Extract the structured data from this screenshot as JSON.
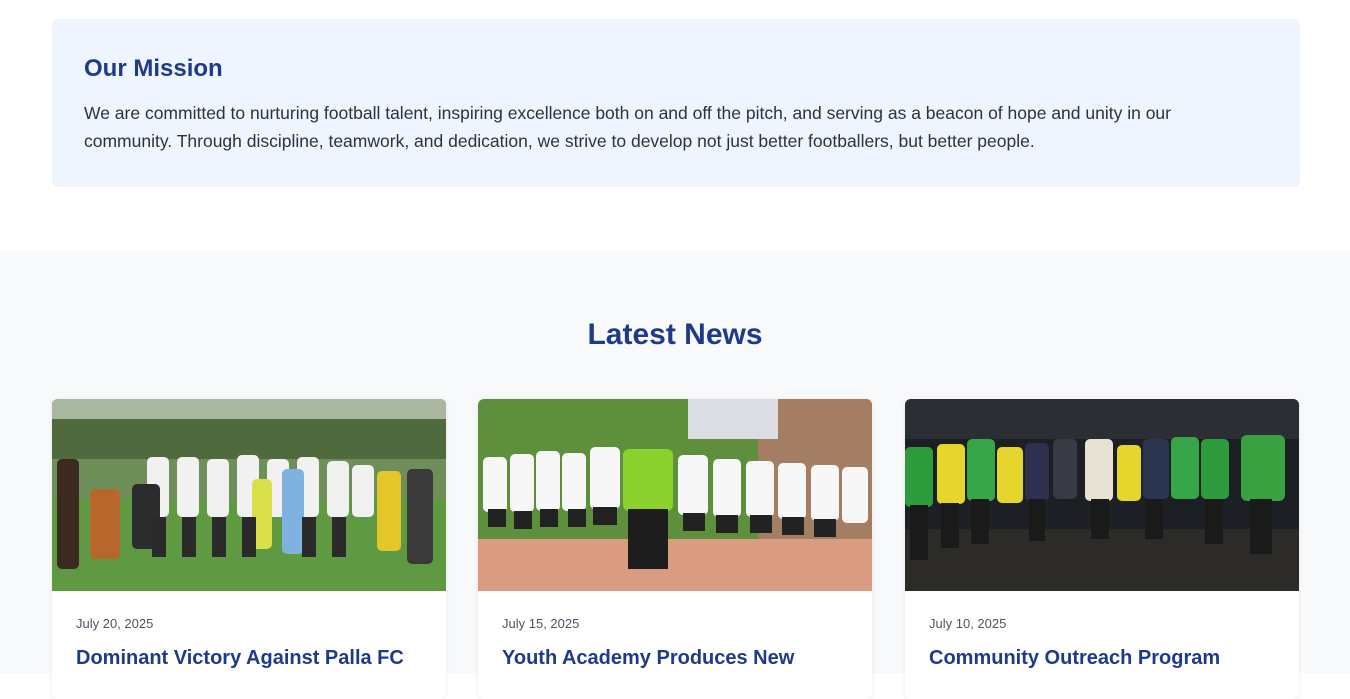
{
  "mission": {
    "title": "Our Mission",
    "text": "We are committed to nurturing football talent, inspiring excellence both on and off the pitch, and serving as a beacon of hope and unity in our community. Through discipline, teamwork, and dedication, we strive to develop not just better footballers, but better people."
  },
  "news": {
    "heading": "Latest News",
    "items": [
      {
        "date": "July 20, 2025",
        "title": "Dominant Victory Against Palla FC"
      },
      {
        "date": "July 15, 2025",
        "title": "Youth Academy Produces New"
      },
      {
        "date": "July 10, 2025",
        "title": "Community Outreach Program"
      }
    ]
  },
  "colors": {
    "heading_blue": "#1e3a8a",
    "mission_bg": "#eef5ff",
    "section_bg": "#f8f9fb"
  }
}
